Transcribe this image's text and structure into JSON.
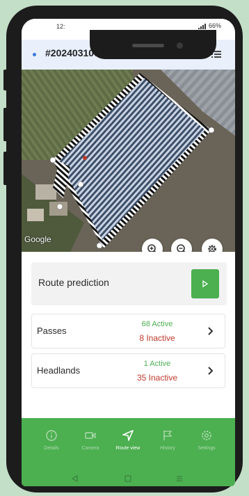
{
  "status_bar": {
    "time": "12:",
    "battery": "66%"
  },
  "header": {
    "title": "#20240310046",
    "dot_color": "#3b7be0",
    "menu_icon": "list-icon"
  },
  "map": {
    "attribution": "Google",
    "controls": [
      {
        "name": "zoom-in-icon"
      },
      {
        "name": "zoom-out-icon"
      },
      {
        "name": "settings-gear-icon"
      }
    ]
  },
  "route_prediction": {
    "label": "Route prediction",
    "button_icon": "play-icon",
    "button_color": "#4caf50"
  },
  "passes": {
    "label": "Passes",
    "active": "68 Active",
    "inactive": "8 Inactive"
  },
  "headlands": {
    "label": "Headlands",
    "active": "1 Active",
    "inactive": "35 Inactive"
  },
  "bottom_nav": {
    "items": [
      {
        "label": "Details",
        "icon": "info-icon"
      },
      {
        "label": "Camera",
        "icon": "video-camera-icon"
      },
      {
        "label": "Route view",
        "icon": "navigation-arrow-icon"
      },
      {
        "label": "History",
        "icon": "flag-icon"
      },
      {
        "label": "Settings",
        "icon": "gear-icon"
      }
    ],
    "active_index": 2
  },
  "colors": {
    "accent": "#4caf50",
    "active_text": "#4caf50",
    "inactive_text": "#c0392b",
    "header_bg": "#e9f0fb"
  }
}
